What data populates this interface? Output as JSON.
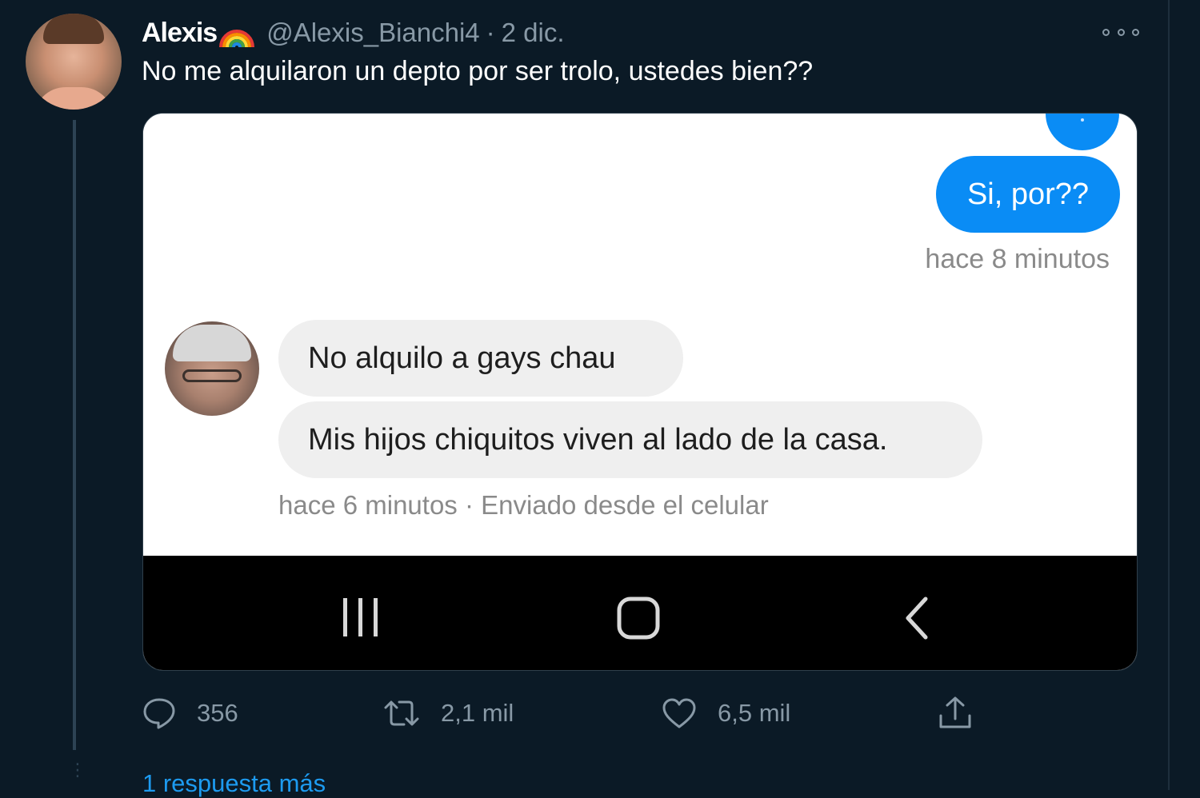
{
  "tweet": {
    "display_name": "Alexis",
    "name_emoji": "rainbow",
    "handle": "@Alexis_Bianchi4",
    "separator": "·",
    "date": "2 dic.",
    "text": "No me alquilaron un depto por ser trolo, ustedes bien??"
  },
  "screenshot": {
    "sent_message": "Si, por??",
    "sent_time": "hace 8 minutos",
    "received_messages": [
      "No alquilo a gays  chau",
      "Mis hijos chiquitos viven al lado de la casa."
    ],
    "received_meta": "hace 6 minutos · Enviado desde el celular",
    "nav_icons": [
      "recent-apps-icon",
      "home-icon",
      "back-icon"
    ]
  },
  "actions": {
    "replies": "356",
    "retweets": "2,1 mil",
    "likes": "6,5 mil"
  },
  "thread": {
    "more_replies": "1 respuesta más"
  },
  "colors": {
    "background": "#0b1a26",
    "muted_text": "#8899a6",
    "accent": "#1d9bf0",
    "messenger_blue": "#0a8cf5"
  }
}
